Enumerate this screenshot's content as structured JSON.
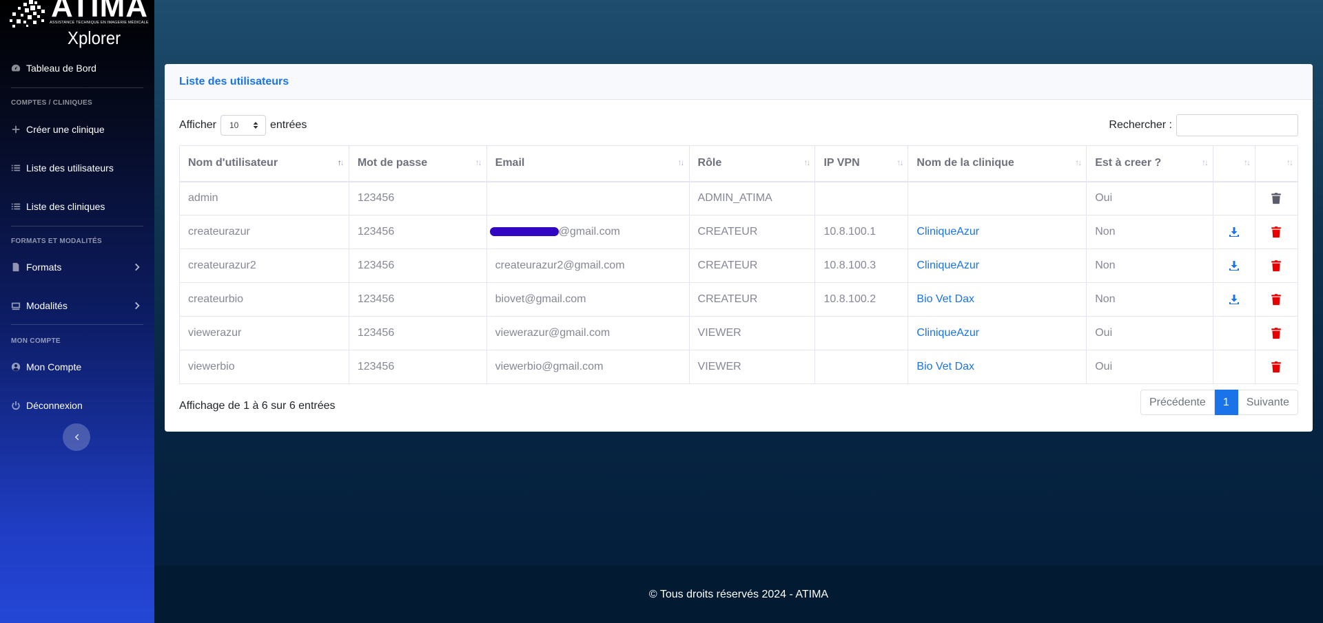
{
  "brand": {
    "name": "ATIMA",
    "tagline": "ASSISTANCE TECHNIQUE EN IMAGERIE MÉDICALE",
    "product": "Xplorer"
  },
  "sidebar": {
    "dashboard": "Tableau de Bord",
    "section_accounts": "COMPTES / CLINIQUES",
    "create_clinic": "Créer une clinique",
    "user_list": "Liste des utilisateurs",
    "clinic_list": "Liste des cliniques",
    "section_formats": "FORMATS ET MODALITÉS",
    "formats": "Formats",
    "modalities": "Modalités",
    "section_account": "MON COMPTE",
    "my_account": "Mon Compte",
    "logout": "Déconnexion"
  },
  "card": {
    "title": "Liste des utilisateurs",
    "show_label": "Afficher",
    "page_size": "10",
    "entries_label": "entrées",
    "search_label": "Rechercher :",
    "search_value": "",
    "info": "Affichage de 1 à 6 sur 6 entrées"
  },
  "table": {
    "headers": [
      "Nom d'utilisateur",
      "Mot de passe",
      "Email",
      "Rôle",
      "IP VPN",
      "Nom de la clinique",
      "Est à creer ?",
      "",
      ""
    ],
    "rows": [
      {
        "user": "admin",
        "pass": "123456",
        "email": "",
        "role": "ADMIN_ATIMA",
        "ip": "",
        "clinic": "",
        "create": "Oui"
      },
      {
        "user": "createurazur",
        "pass": "123456",
        "email": "@gmail.com",
        "role": "CREATEUR",
        "ip": "10.8.100.1",
        "clinic": "CliniqueAzur",
        "create": "Non"
      },
      {
        "user": "createurazur2",
        "pass": "123456",
        "email": "createurazur2@gmail.com",
        "role": "CREATEUR",
        "ip": "10.8.100.3",
        "clinic": "CliniqueAzur",
        "create": "Non"
      },
      {
        "user": "createurbio",
        "pass": "123456",
        "email": "biovet@gmail.com",
        "role": "CREATEUR",
        "ip": "10.8.100.2",
        "clinic": "Bio Vet Dax",
        "create": "Non"
      },
      {
        "user": "viewerazur",
        "pass": "123456",
        "email": "viewerazur@gmail.com",
        "role": "VIEWER",
        "ip": "",
        "clinic": "CliniqueAzur",
        "create": "Oui"
      },
      {
        "user": "viewerbio",
        "pass": "123456",
        "email": "viewerbio@gmail.com",
        "role": "VIEWER",
        "ip": "",
        "clinic": "Bio Vet Dax",
        "create": "Oui"
      }
    ]
  },
  "pagination": {
    "prev": "Précédente",
    "current": "1",
    "next": "Suivante"
  },
  "footer": "© Tous droits réservés 2024 - ATIMA",
  "colors": {
    "accent": "#1a73e8",
    "delete_red": "#e60000",
    "delete_gray": "#5a5c69"
  }
}
